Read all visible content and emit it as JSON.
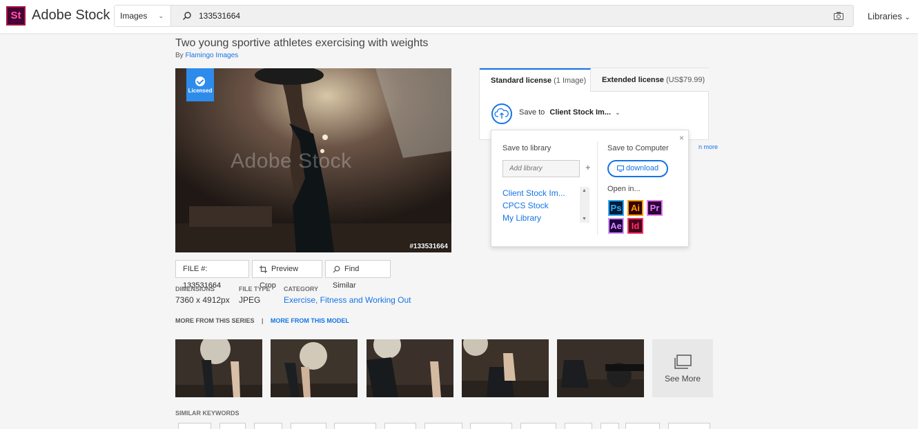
{
  "header": {
    "logo": "St",
    "brand": "Adobe Stock",
    "search_type": "Images",
    "search_value": "133531664",
    "libraries_label": "Libraries"
  },
  "asset": {
    "title": "Two young sportive athletes exercising with weights",
    "by_prefix": "By",
    "author": "Flamingo Images",
    "licensed_label": "Licensed",
    "watermark": "Adobe Stock",
    "image_id": "#133531664",
    "file_label": "FILE #:",
    "file_number": "133531664",
    "preview_crop": "Preview Crop",
    "find_similar": "Find Similar",
    "dimensions_label": "DIMENSIONS",
    "dimensions": "7360 x 4912px",
    "filetype_label": "FILE TYPE",
    "filetype": "JPEG",
    "category_label": "CATEGORY",
    "category": "Exercise, Fitness and Working Out",
    "more_series": "MORE FROM THIS SERIES",
    "separator": "|",
    "more_model": "MORE FROM THIS MODEL",
    "see_more": "See More",
    "similar_keywords": "SIMILAR KEYWORDS"
  },
  "license": {
    "standard_label": "Standard license",
    "standard_note": "(1 Image)",
    "extended_label": "Extended license",
    "extended_note": "(US$79.99)",
    "save_to": "Save to",
    "save_target": "Client Stock Im...",
    "learn_more": "n more"
  },
  "popup": {
    "close": "×",
    "save_library": "Save to library",
    "add_library_placeholder": "Add library",
    "plus": "+",
    "libraries": [
      "Client Stock Im...",
      "CPCS Stock",
      "My Library"
    ],
    "save_computer": "Save to Computer",
    "download": "download",
    "open_in": "Open in...",
    "apps": [
      {
        "label": "Ps",
        "color": "#31a8ff",
        "bg": "#001e36"
      },
      {
        "label": "Ai",
        "color": "#ff9a00",
        "bg": "#330000"
      },
      {
        "label": "Pr",
        "color": "#ea77ff",
        "bg": "#2a0634"
      },
      {
        "label": "Ae",
        "color": "#d291ff",
        "bg": "#1f0040"
      },
      {
        "label": "Id",
        "color": "#ff3366",
        "bg": "#49021f"
      }
    ]
  }
}
